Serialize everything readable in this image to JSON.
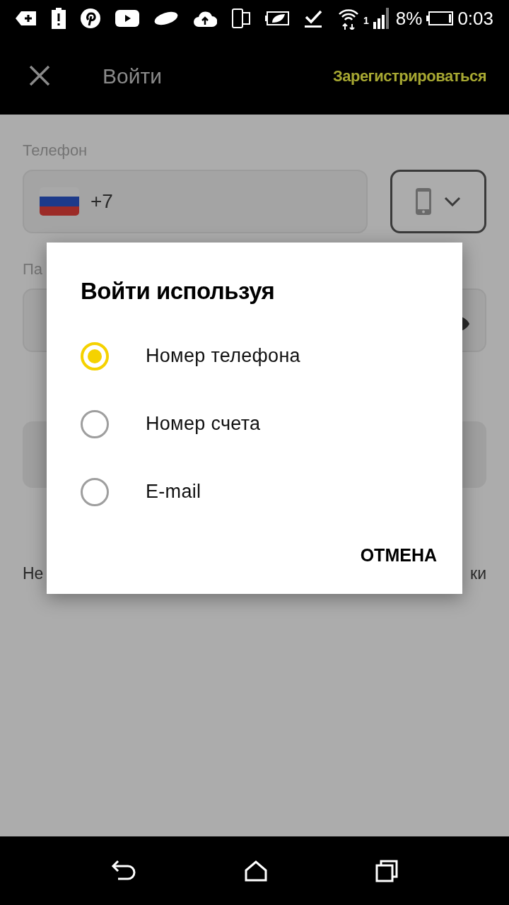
{
  "status_bar": {
    "sim": "1",
    "battery": "8%",
    "time": "0:03"
  },
  "app_bar": {
    "title": "Войти",
    "action": "Зарегистрироваться"
  },
  "form": {
    "phone_label": "Телефон",
    "country_code": "+7",
    "second_label": "Па",
    "footer_left": "Не",
    "footer_right": "ки"
  },
  "dialog": {
    "title": "Войти используя",
    "options": [
      {
        "label": "Номер телефона",
        "selected": true
      },
      {
        "label": "Номер счета",
        "selected": false
      },
      {
        "label": "E-mail",
        "selected": false
      }
    ],
    "button": "ОТМЕНА"
  }
}
